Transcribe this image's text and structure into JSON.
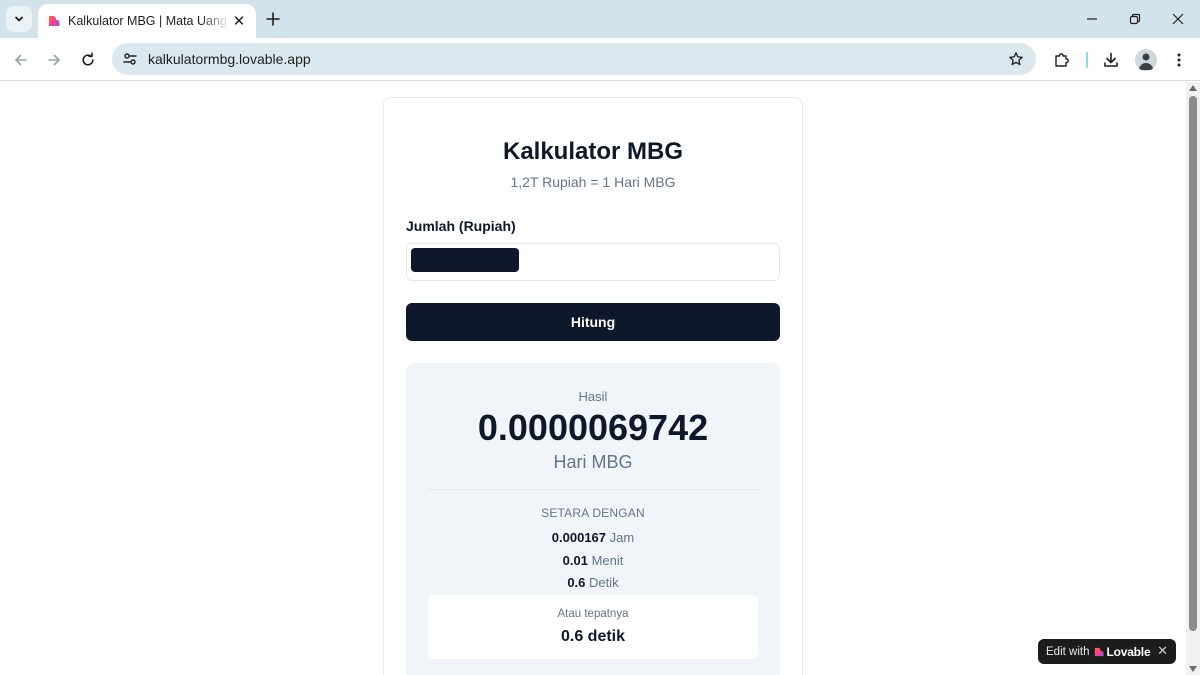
{
  "browser": {
    "tab_title": "Kalkulator MBG | Mata Uang Ga",
    "url": "kalkulatormbg.lovable.app"
  },
  "app": {
    "title": "Kalkulator MBG",
    "subtitle": "1,2T Rupiah = 1 Hari MBG",
    "amount_label": "Jumlah (Rupiah)",
    "calculate_button": "Hitung",
    "result": {
      "label": "Hasil",
      "value": "0.0000069742",
      "unit": "Hari MBG",
      "equivalent_label": "SETARA DENGAN",
      "equivalents": [
        {
          "value": "0.000167",
          "unit": "Jam"
        },
        {
          "value": "0.01",
          "unit": "Menit"
        },
        {
          "value": "0.6",
          "unit": "Detik"
        }
      ],
      "exact_label": "Atau tepatnya",
      "exact_value": "0.6 detik"
    }
  },
  "badge": {
    "prefix": "Edit with",
    "brand": "Lovable",
    "close": "✕"
  },
  "colors": {
    "primary": "#0f172a",
    "muted_text": "#64748b",
    "result_bg": "#f1f5f9",
    "chrome_bg": "#d3e3ec"
  }
}
